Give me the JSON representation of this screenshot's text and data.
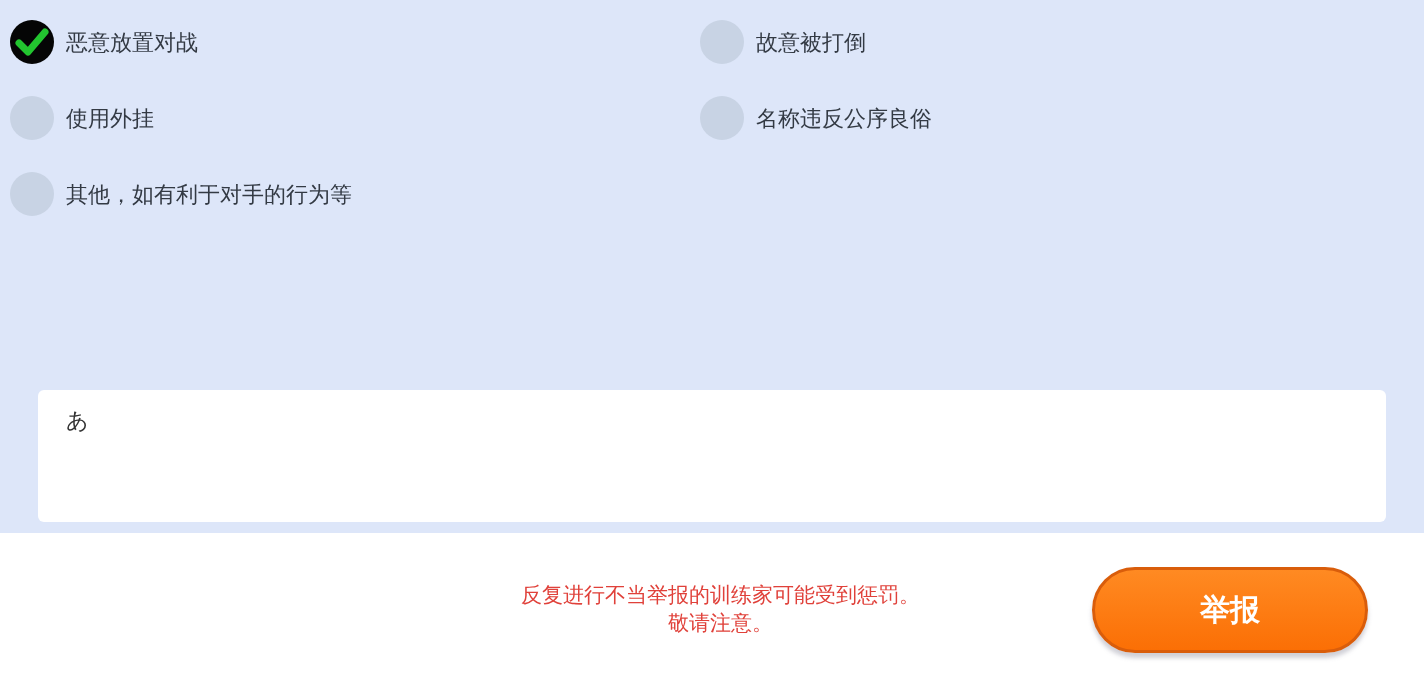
{
  "reasons": [
    {
      "label": "恶意放置对战",
      "checked": true
    },
    {
      "label": "故意被打倒",
      "checked": false
    },
    {
      "label": "使用外挂",
      "checked": false
    },
    {
      "label": "名称违反公序良俗",
      "checked": false
    },
    {
      "label": "其他，如有利于对手的行为等",
      "checked": false
    }
  ],
  "comment": {
    "value": "あ"
  },
  "warning": [
    "反复进行不当举报的训练家可能受到惩罚。",
    "敬请注意。"
  ],
  "submit_button": "举报"
}
